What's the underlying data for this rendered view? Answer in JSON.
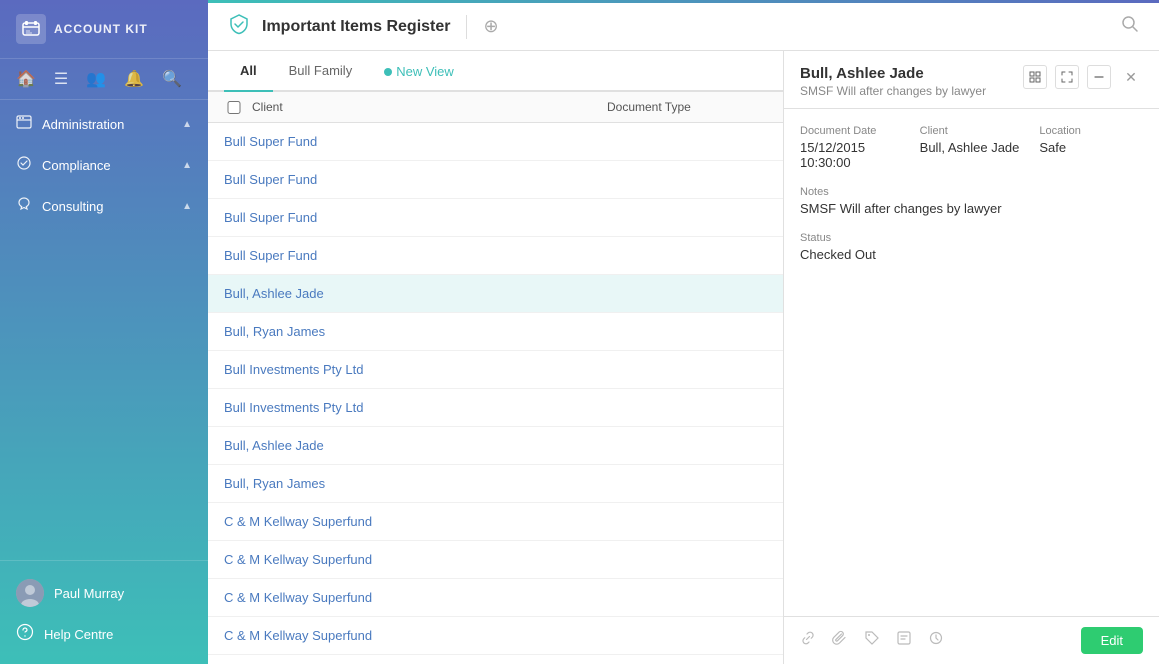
{
  "app": {
    "name": "ACCOUNT KIT"
  },
  "header": {
    "title": "Important Items Register",
    "plus_icon": "+",
    "search_icon": "🔍"
  },
  "sidebar": {
    "nav_icons": [
      "🏠",
      "☰",
      "👥",
      "🔔",
      "🔍"
    ],
    "items": [
      {
        "id": "administration",
        "label": "Administration",
        "icon": "📁"
      },
      {
        "id": "compliance",
        "label": "Compliance",
        "icon": "💲"
      },
      {
        "id": "consulting",
        "label": "Consulting",
        "icon": "🤝"
      }
    ],
    "bottom": {
      "user_name": "Paul Murray",
      "help_label": "Help Centre"
    }
  },
  "tabs": [
    {
      "id": "all",
      "label": "All",
      "active": true
    },
    {
      "id": "bull-family",
      "label": "Bull Family",
      "active": false
    },
    {
      "id": "new-view",
      "label": "New View",
      "active": false
    }
  ],
  "table": {
    "headers": {
      "client": "Client",
      "document_type": "Document Type"
    },
    "rows": [
      {
        "id": 1,
        "client": "Bull Super Fund",
        "doc_type": "",
        "selected": false
      },
      {
        "id": 2,
        "client": "Bull Super Fund",
        "doc_type": "",
        "selected": false
      },
      {
        "id": 3,
        "client": "Bull Super Fund",
        "doc_type": "",
        "selected": false
      },
      {
        "id": 4,
        "client": "Bull Super Fund",
        "doc_type": "",
        "selected": false
      },
      {
        "id": 5,
        "client": "Bull, Ashlee Jade",
        "doc_type": "",
        "selected": true
      },
      {
        "id": 6,
        "client": "Bull, Ryan James",
        "doc_type": "",
        "selected": false
      },
      {
        "id": 7,
        "client": "Bull Investments Pty Ltd",
        "doc_type": "",
        "selected": false
      },
      {
        "id": 8,
        "client": "Bull Investments Pty Ltd",
        "doc_type": "",
        "selected": false
      },
      {
        "id": 9,
        "client": "Bull, Ashlee Jade",
        "doc_type": "",
        "selected": false
      },
      {
        "id": 10,
        "client": "Bull, Ryan James",
        "doc_type": "",
        "selected": false
      },
      {
        "id": 11,
        "client": "C & M Kellway Superfund",
        "doc_type": "",
        "selected": false
      },
      {
        "id": 12,
        "client": "C & M Kellway Superfund",
        "doc_type": "",
        "selected": false
      },
      {
        "id": 13,
        "client": "C & M Kellway Superfund",
        "doc_type": "",
        "selected": false
      },
      {
        "id": 14,
        "client": "C & M Kellway Superfund",
        "doc_type": "",
        "selected": false
      }
    ]
  },
  "detail": {
    "title": "Bull, Ashlee Jade",
    "subtitle": "SMSF Will after changes by lawyer",
    "fields": {
      "document_date_label": "Document Date",
      "document_date_value": "15/12/2015 10:30:00",
      "client_label": "Client",
      "client_value": "Bull, Ashlee Jade",
      "location_label": "Location",
      "location_value": "Safe",
      "notes_label": "Notes",
      "notes_value": "SMSF Will after changes by lawyer",
      "status_label": "Status",
      "status_value": "Checked Out"
    },
    "actions": {
      "edit_label": "Edit"
    },
    "footer_icons": [
      "🔗",
      "🔗",
      "🏷",
      "📋",
      "🕐"
    ]
  }
}
